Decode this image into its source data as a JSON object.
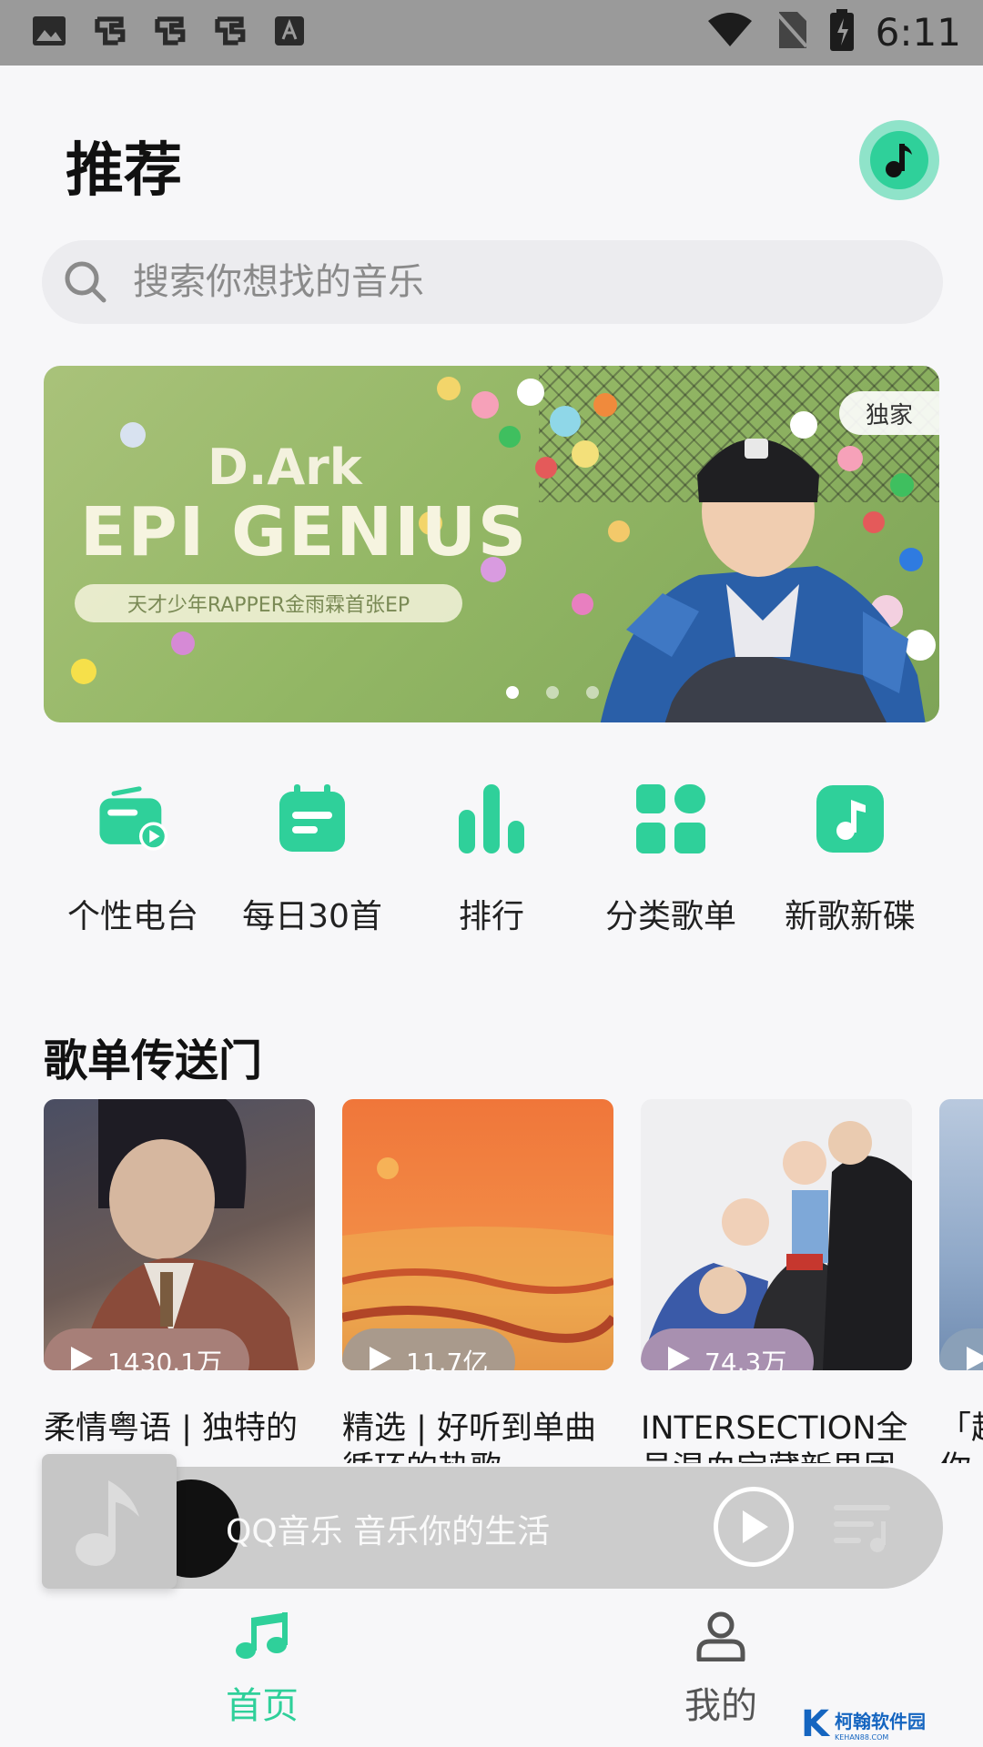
{
  "status_bar": {
    "time": "6:11"
  },
  "header": {
    "title": "推荐"
  },
  "search": {
    "placeholder": "搜索你想找的音乐"
  },
  "banner": {
    "line1": "D.Ark",
    "line2": "EPI GENIUS",
    "subtitle": "天才少年RAPPER金雨霖首张EP",
    "tag": "独家",
    "active_dot": 0,
    "dot_count": 3
  },
  "quick_nav": [
    {
      "label": "个性电台",
      "icon": "radio-icon"
    },
    {
      "label": "每日30首",
      "icon": "calendar-icon"
    },
    {
      "label": "排行",
      "icon": "chart-bars-icon"
    },
    {
      "label": "分类歌单",
      "icon": "grid-icon"
    },
    {
      "label": "新歌新碟",
      "icon": "music-note-icon"
    }
  ],
  "section": {
    "title": "歌单传送门"
  },
  "playlists": [
    {
      "plays": "1430.1万",
      "title": "柔情粤语 | 独特的",
      "pill_color": "#a77f78"
    },
    {
      "plays": "11.7亿",
      "title": "精选 | 好听到单曲循环的热歌",
      "pill_color": "#a99a8c"
    },
    {
      "plays": "74.3万",
      "title": "INTERSECTION全员混血宝藏新男团",
      "pill_color": "#a890b0"
    },
    {
      "plays": "",
      "title": "「超你有",
      "pill_color": "#8aa0b8"
    }
  ],
  "mini_player": {
    "text": "QQ音乐 音乐你的生活"
  },
  "bottom_nav": [
    {
      "label": "首页",
      "active": true,
      "icon": "music-note-icon"
    },
    {
      "label": "我的",
      "active": false,
      "icon": "user-icon"
    }
  ],
  "colors": {
    "accent": "#2fd09a",
    "inactive": "#555555"
  },
  "watermark": {
    "cn": "柯翰软件园",
    "en": "KEHAN88.COM",
    "letter": "K"
  }
}
